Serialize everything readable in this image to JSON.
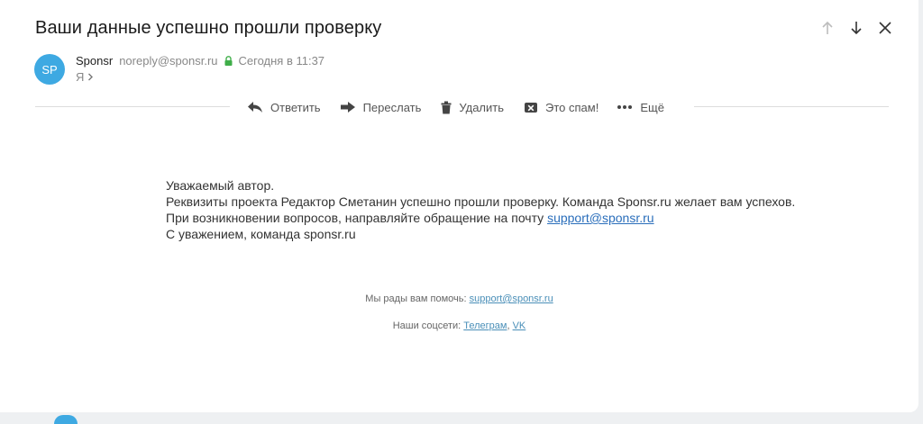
{
  "email": {
    "subject": "Ваши данные успешно прошли проверку",
    "sender": {
      "avatar_initials": "SP",
      "avatar_color": "#3ea9e2",
      "name": "Sponsr",
      "address": "noreply@sponsr.ru",
      "time": "Сегодня в 11:37",
      "verified_icon": "lock-icon"
    },
    "recipient": "Я"
  },
  "navigation": {
    "icons": [
      "arrow-up-icon",
      "arrow-down-icon",
      "close-icon"
    ]
  },
  "toolbar": {
    "reply": "Ответить",
    "forward": "Переслать",
    "delete": "Удалить",
    "spam": "Это спам!",
    "more": "Ещё"
  },
  "body": {
    "greeting": "Уважаемый автор.",
    "line1": "Реквизиты проекта Редактор Сметанин успешно прошли проверку. Команда Sponsr.ru желает вам успехов.",
    "line2_prefix": "При возникновении вопросов, направляйте обращение на почту ",
    "support_email": "support@sponsr.ru",
    "signature": "С уважением, команда sponsr.ru"
  },
  "footer": {
    "help_prefix": "Мы рады вам помочь: ",
    "help_email": "support@sponsr.ru",
    "social_prefix": "Наши соцсети: ",
    "social_telegram": "Телеграм",
    "social_separator": ", ",
    "social_vk": "VK"
  },
  "colors": {
    "avatar": "#3ea9e2",
    "link": "#2a6ebb",
    "lock": "#3fae49"
  }
}
